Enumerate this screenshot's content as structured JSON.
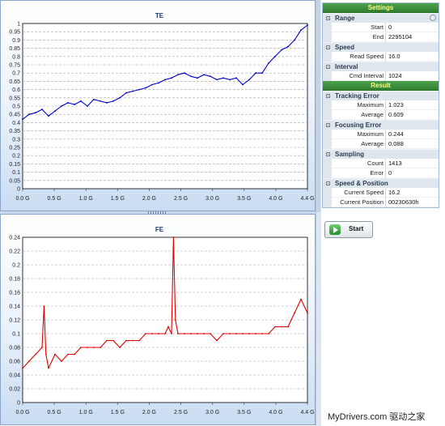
{
  "charts": {
    "te": {
      "title": "TE"
    },
    "fe": {
      "title": "FE"
    }
  },
  "chart_data": [
    {
      "type": "line",
      "title": "TE",
      "xlabel": "",
      "ylabel": "",
      "xlim": [
        0,
        4.4
      ],
      "ylim": [
        0,
        1.0
      ],
      "x_ticks": [
        "0.0 G",
        "0.5 G",
        "1.0 G",
        "1.5 G",
        "2.0 G",
        "2.5 G",
        "3.0 G",
        "3.5 G",
        "4.0 G",
        "4.4 G"
      ],
      "y_ticks": [
        "0",
        "0.05",
        "0.1",
        "0.15",
        "0.2",
        "0.25",
        "0.3",
        "0.35",
        "0.4",
        "0.45",
        "0.5",
        "0.55",
        "0.6",
        "0.65",
        "0.7",
        "0.75",
        "0.8",
        "0.85",
        "0.9",
        "0.95",
        "1"
      ],
      "grid": true,
      "series": [
        {
          "color": "#0000c8",
          "x": [
            0.0,
            0.1,
            0.2,
            0.3,
            0.4,
            0.5,
            0.6,
            0.7,
            0.8,
            0.9,
            1.0,
            1.1,
            1.2,
            1.3,
            1.4,
            1.5,
            1.6,
            1.7,
            1.8,
            1.9,
            2.0,
            2.1,
            2.2,
            2.3,
            2.4,
            2.5,
            2.6,
            2.7,
            2.8,
            2.9,
            3.0,
            3.1,
            3.2,
            3.3,
            3.4,
            3.5,
            3.6,
            3.7,
            3.8,
            3.9,
            4.0,
            4.1,
            4.2,
            4.3,
            4.4
          ],
          "y": [
            0.42,
            0.45,
            0.46,
            0.48,
            0.44,
            0.47,
            0.5,
            0.52,
            0.51,
            0.53,
            0.5,
            0.54,
            0.53,
            0.52,
            0.53,
            0.55,
            0.58,
            0.59,
            0.6,
            0.61,
            0.63,
            0.64,
            0.66,
            0.67,
            0.69,
            0.7,
            0.68,
            0.67,
            0.69,
            0.68,
            0.66,
            0.67,
            0.66,
            0.67,
            0.63,
            0.66,
            0.7,
            0.7,
            0.76,
            0.8,
            0.84,
            0.86,
            0.9,
            0.96,
            0.99
          ]
        }
      ]
    },
    {
      "type": "line",
      "title": "FE",
      "xlabel": "",
      "ylabel": "",
      "xlim": [
        0,
        4.4
      ],
      "ylim": [
        0,
        0.24
      ],
      "x_ticks": [
        "0.0 G",
        "0.5 G",
        "1.0 G",
        "1.5 G",
        "2.0 G",
        "2.5 G",
        "3.0 G",
        "3.5 G",
        "4.0 G",
        "4.4 G"
      ],
      "y_ticks": [
        "0",
        "0.02",
        "0.04",
        "0.06",
        "0.08",
        "0.1",
        "0.12",
        "0.14",
        "0.16",
        "0.18",
        "0.2",
        "0.22",
        "0.24"
      ],
      "grid": true,
      "series": [
        {
          "color": "#e00000",
          "x": [
            0.0,
            0.1,
            0.2,
            0.3,
            0.33,
            0.36,
            0.4,
            0.5,
            0.6,
            0.7,
            0.8,
            0.9,
            1.0,
            1.1,
            1.2,
            1.3,
            1.4,
            1.5,
            1.6,
            1.7,
            1.8,
            1.9,
            2.0,
            2.1,
            2.2,
            2.25,
            2.3,
            2.33,
            2.36,
            2.4,
            2.5,
            2.6,
            2.7,
            2.8,
            2.9,
            3.0,
            3.1,
            3.2,
            3.3,
            3.4,
            3.5,
            3.6,
            3.7,
            3.8,
            3.9,
            4.0,
            4.1,
            4.2,
            4.3,
            4.4
          ],
          "y": [
            0.05,
            0.06,
            0.07,
            0.08,
            0.14,
            0.07,
            0.05,
            0.07,
            0.06,
            0.07,
            0.07,
            0.08,
            0.08,
            0.08,
            0.08,
            0.09,
            0.09,
            0.08,
            0.09,
            0.09,
            0.09,
            0.1,
            0.1,
            0.1,
            0.1,
            0.11,
            0.1,
            0.24,
            0.12,
            0.1,
            0.1,
            0.1,
            0.1,
            0.1,
            0.1,
            0.09,
            0.1,
            0.1,
            0.1,
            0.1,
            0.1,
            0.1,
            0.1,
            0.1,
            0.11,
            0.11,
            0.11,
            0.13,
            0.15,
            0.13
          ]
        }
      ]
    }
  ],
  "settings_title": "Settings",
  "sections": {
    "range": {
      "label": "Range",
      "start_key": "Start",
      "start_val": "0",
      "end_key": "End",
      "end_val": "2295104"
    },
    "speed": {
      "label": "Speed",
      "read_key": "Read Speed",
      "read_val": "16.0"
    },
    "interval": {
      "label": "Interval",
      "cmd_key": "Cmd Interval",
      "cmd_val": "1024"
    }
  },
  "result_title": "Result",
  "results": {
    "tracking": {
      "label": "Tracking Error",
      "max_key": "Maximum",
      "max_val": "1.023",
      "avg_key": "Average",
      "avg_val": "0.609"
    },
    "focusing": {
      "label": "Focusing Error",
      "max_key": "Maximum",
      "max_val": "0.244",
      "avg_key": "Average",
      "avg_val": "0.088"
    },
    "sampling": {
      "label": "Sampling",
      "count_key": "Count",
      "count_val": "1413",
      "error_key": "Error",
      "error_val": "0"
    },
    "speedpos": {
      "label": "Speed & Position",
      "cs_key": "Current Speed",
      "cs_val": "16.2",
      "cp_key": "Current Position",
      "cp_val": "00230630h"
    }
  },
  "start_button": "Start",
  "watermark": "MyDrivers.com 驱动之家",
  "icons": {
    "start": "play-icon",
    "collapse": "collapse-icon",
    "settings_toggle": "settings-toggle-icon"
  }
}
